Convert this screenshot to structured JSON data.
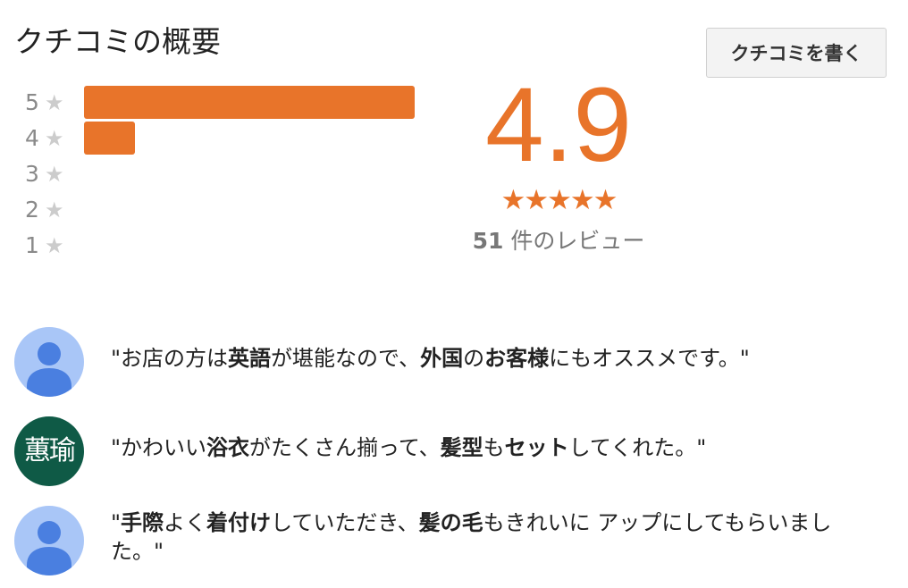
{
  "header": {
    "title": "クチコミの概要",
    "write_button_label": "クチコミを書く"
  },
  "histogram": {
    "rows": [
      {
        "stars": "5",
        "fraction": 1.0
      },
      {
        "stars": "4",
        "fraction": 0.155
      },
      {
        "stars": "3",
        "fraction": 0.0
      },
      {
        "stars": "2",
        "fraction": 0.0
      },
      {
        "stars": "1",
        "fraction": 0.0
      }
    ],
    "star_glyph": "★",
    "bar_color": "#e8742a",
    "star_color": "#cccccc"
  },
  "summary": {
    "score": "4.9",
    "stars": "★★★★★",
    "count": "51",
    "count_label": " 件のレビュー",
    "accent_color": "#e8742a"
  },
  "reviews": [
    {
      "avatar": "default-user-icon",
      "parts": [
        {
          "t": "\"お店の方は",
          "b": false
        },
        {
          "t": "英語",
          "b": true
        },
        {
          "t": "が堪能なので、",
          "b": false
        },
        {
          "t": "外国",
          "b": true
        },
        {
          "t": "の",
          "b": false
        },
        {
          "t": "お客様",
          "b": true
        },
        {
          "t": "にもオススメです。\"",
          "b": false
        }
      ]
    },
    {
      "avatar_text": "蕙瑜",
      "avatar_color": "#0f5a46",
      "parts": [
        {
          "t": "\"かわいい",
          "b": false
        },
        {
          "t": "浴衣",
          "b": true
        },
        {
          "t": "がたくさん揃って、",
          "b": false
        },
        {
          "t": "髪型",
          "b": true
        },
        {
          "t": "も",
          "b": false
        },
        {
          "t": "セット",
          "b": true
        },
        {
          "t": "してくれた。\"",
          "b": false
        }
      ]
    },
    {
      "avatar": "default-user-icon",
      "parts": [
        {
          "t": "\"",
          "b": false
        },
        {
          "t": "手際",
          "b": true
        },
        {
          "t": "よく",
          "b": false
        },
        {
          "t": "着付け",
          "b": true
        },
        {
          "t": "していただき、",
          "b": false
        },
        {
          "t": "髪の毛",
          "b": true
        },
        {
          "t": "もきれいに アップにしてもらいました。\"",
          "b": false
        }
      ]
    }
  ]
}
